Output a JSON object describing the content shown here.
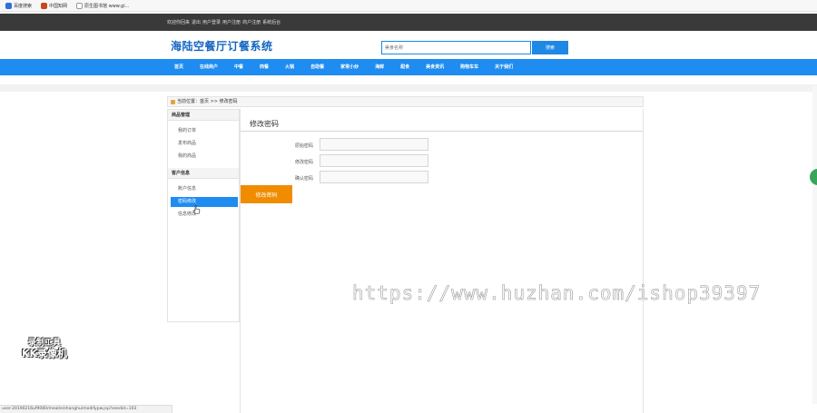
{
  "browser": {
    "bookmarks": [
      {
        "label": "百度搜索",
        "icon": "paw-icon",
        "color": "#2e6fdc"
      },
      {
        "label": "中国知网",
        "icon": "book-icon",
        "color": "#c9481c"
      },
      {
        "label": "原生图书馆 www.gi...",
        "icon": "page-icon",
        "color": "#999999"
      }
    ],
    "status_url": "user-20190216uf9080/meal/e/shanghu/modifypw.jsp?seedid=103"
  },
  "topbar": {
    "links": [
      "欢迎你回来",
      "退出",
      "用户登录",
      "用户注册",
      "商户注册",
      "系统后台"
    ]
  },
  "header": {
    "site_title": "海陆空餐厅订餐系统",
    "search_placeholder": "美食名称",
    "search_button": "搜索"
  },
  "nav": {
    "items": [
      "首页",
      "在线商户",
      "中餐",
      "西餐",
      "火锅",
      "自助餐",
      "家常小炒",
      "海鲜",
      "甜食",
      "美食资讯",
      "购物车车",
      "关于我们"
    ]
  },
  "breadcrumb": {
    "text": "当前位置：首页 >> 修改密码"
  },
  "sidebar": {
    "groups": [
      {
        "title": "商品管理",
        "items": [
          "我的订单",
          "发布商品",
          "我的商品"
        ]
      },
      {
        "title": "客户信息",
        "items": [
          "账户信息",
          "密码修改",
          "信息修改"
        ]
      }
    ],
    "active_item": "密码修改"
  },
  "content": {
    "title": "修改密码",
    "fields": [
      {
        "label": "原始密码",
        "value": ""
      },
      {
        "label": "修改密码",
        "value": ""
      },
      {
        "label": "确认密码",
        "value": ""
      }
    ],
    "submit": "修改密码"
  },
  "overlays": {
    "watermark_url": "https://www.huzhan.com/ishop39397",
    "logo_line1": "录制工具",
    "logo_line2": "KK录像机"
  },
  "colors": {
    "accent_blue": "#1e8cf0",
    "submit_orange": "#f08c00",
    "topbar_dark": "#3a3a3a"
  }
}
